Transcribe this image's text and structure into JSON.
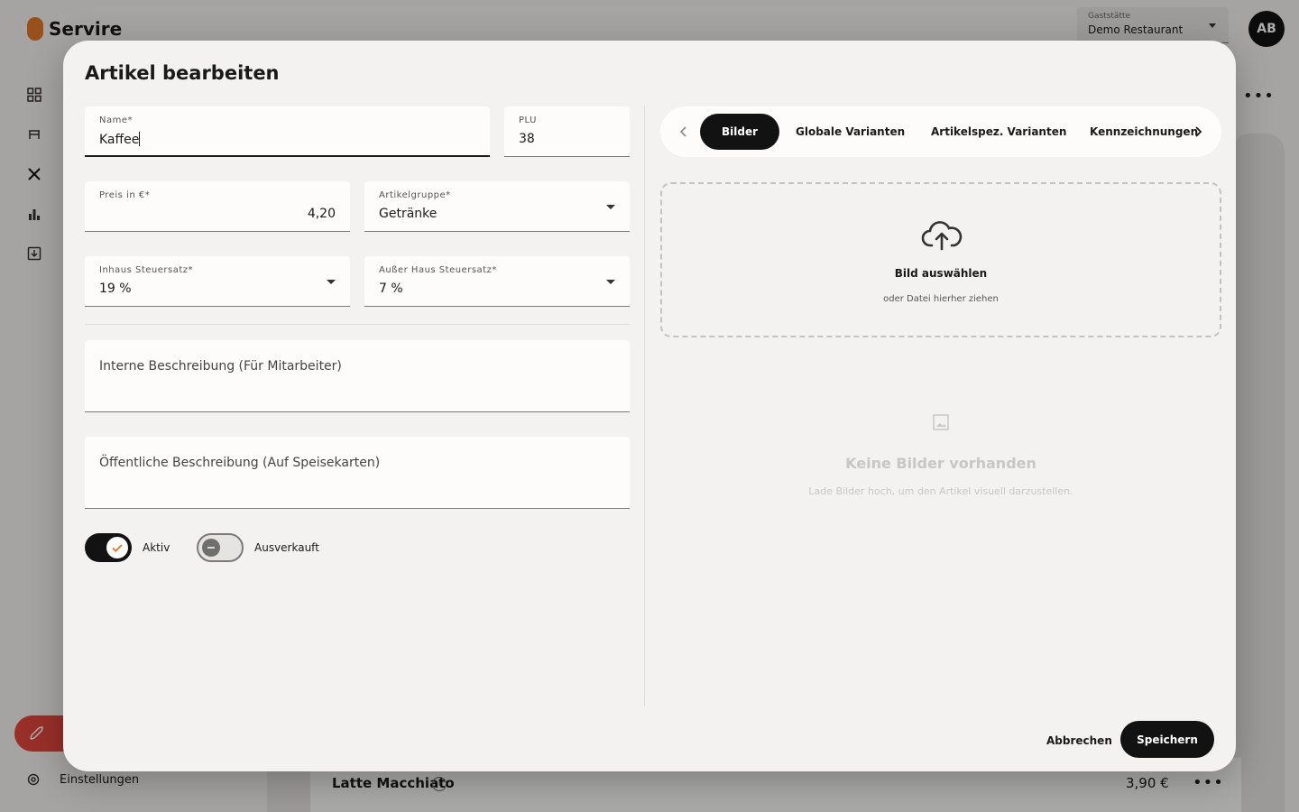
{
  "app": {
    "brand": "Servire",
    "venue_label": "Gaststätte",
    "venue_value": "Demo Restaurant",
    "avatar_initials": "AB",
    "settings_label": "Einstellungen",
    "accent_color": "#e0782a",
    "launch_color": "#e0463c"
  },
  "background_row": {
    "name": "Latte Macchiato",
    "price": "3,90 €"
  },
  "dialog": {
    "title": "Artikel bearbeiten",
    "name_label": "Name*",
    "name_value": "Kaffee",
    "plu_label": "PLU",
    "plu_value": "38",
    "price_label": "Preis in €*",
    "price_value": "4,20",
    "group_label": "Artikelgruppe*",
    "group_value": "Getränke",
    "inhouse_tax_label": "Inhaus Steuersatz*",
    "inhouse_tax_value": "19 %",
    "takeaway_tax_label": "Außer Haus Steuersatz*",
    "takeaway_tax_value": "7 %",
    "internal_desc_placeholder": "Interne Beschreibung (Für Mitarbeiter)",
    "public_desc_placeholder": "Öffentliche Beschreibung (Auf Speisekarten)",
    "active_label": "Aktiv",
    "active_on": true,
    "soldout_label": "Ausverkauft",
    "soldout_on": false,
    "tabs": [
      {
        "label": "Bilder",
        "active": true
      },
      {
        "label": "Globale Varianten",
        "active": false
      },
      {
        "label": "Artikelspez. Varianten",
        "active": false
      },
      {
        "label": "Kennzeichnungen",
        "active": false
      }
    ],
    "upload_title": "Bild auswählen",
    "upload_sub": "oder Datei hierher ziehen",
    "empty_title": "Keine Bilder vorhanden",
    "empty_sub": "Lade Bilder hoch, um den Artikel visuell darzustellen.",
    "cancel_label": "Abbrechen",
    "save_label": "Speichern"
  }
}
